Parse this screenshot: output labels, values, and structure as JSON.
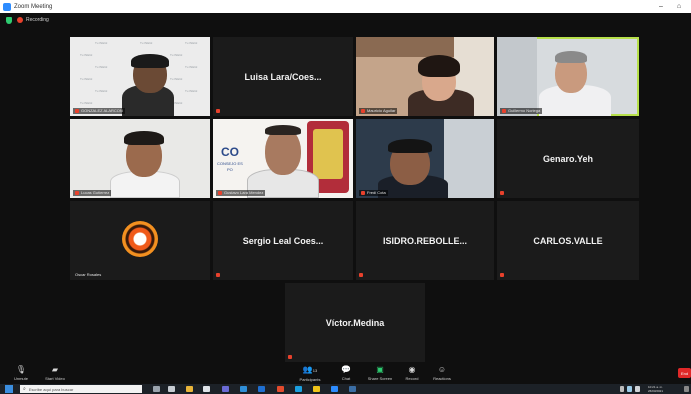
{
  "window": {
    "title": "Zoom Meeting",
    "minimize": "–",
    "restore": "⌂"
  },
  "recording": {
    "label": "Recording"
  },
  "tiles": [
    {
      "name": "",
      "label": "GONZALEZ ALARCON"
    },
    {
      "name": "Luisa Lara/Coes...",
      "label": ""
    },
    {
      "name": "",
      "label": "Mauricio Aguilar"
    },
    {
      "name": "",
      "label": "Guillermo Noriega"
    },
    {
      "name": "",
      "label": "Lucas Gutierrez"
    },
    {
      "name": "",
      "label": "Gustavo Lara Mendez"
    },
    {
      "name": "",
      "label": "Fredi Cota"
    },
    {
      "name": "Genaro.Yeh",
      "label": ""
    },
    {
      "name": "",
      "label": "Oscar Rosales"
    },
    {
      "name": "Sergio Leal Coes...",
      "label": ""
    },
    {
      "name": "ISIDRO.REBOLLE...",
      "label": ""
    },
    {
      "name": "CARLOS.VALLE",
      "label": ""
    },
    {
      "name": "Víctor.Medina",
      "label": ""
    }
  ],
  "tile6_text": {
    "line1": "CO",
    "line2": "CONSEJO ES",
    "line3": "PO"
  },
  "tile1_watermark": "Tu INEGI",
  "controls": {
    "unmute": "Unmute",
    "start_video": "Start Video",
    "participants": "Participants",
    "participants_count": "13",
    "chat": "Chat",
    "share_screen": "Share Screen",
    "record": "Record",
    "reactions": "Reactions",
    "end": "End"
  },
  "taskbar": {
    "search_placeholder": "Escribe aquí para buscar",
    "time": "10:21 a. m.",
    "date": "26/03/2021"
  },
  "colors": {
    "active_speaker": "#b7e04b",
    "recording": "#e8412c",
    "share_screen": "#2ecc71",
    "end": "#e02828"
  }
}
